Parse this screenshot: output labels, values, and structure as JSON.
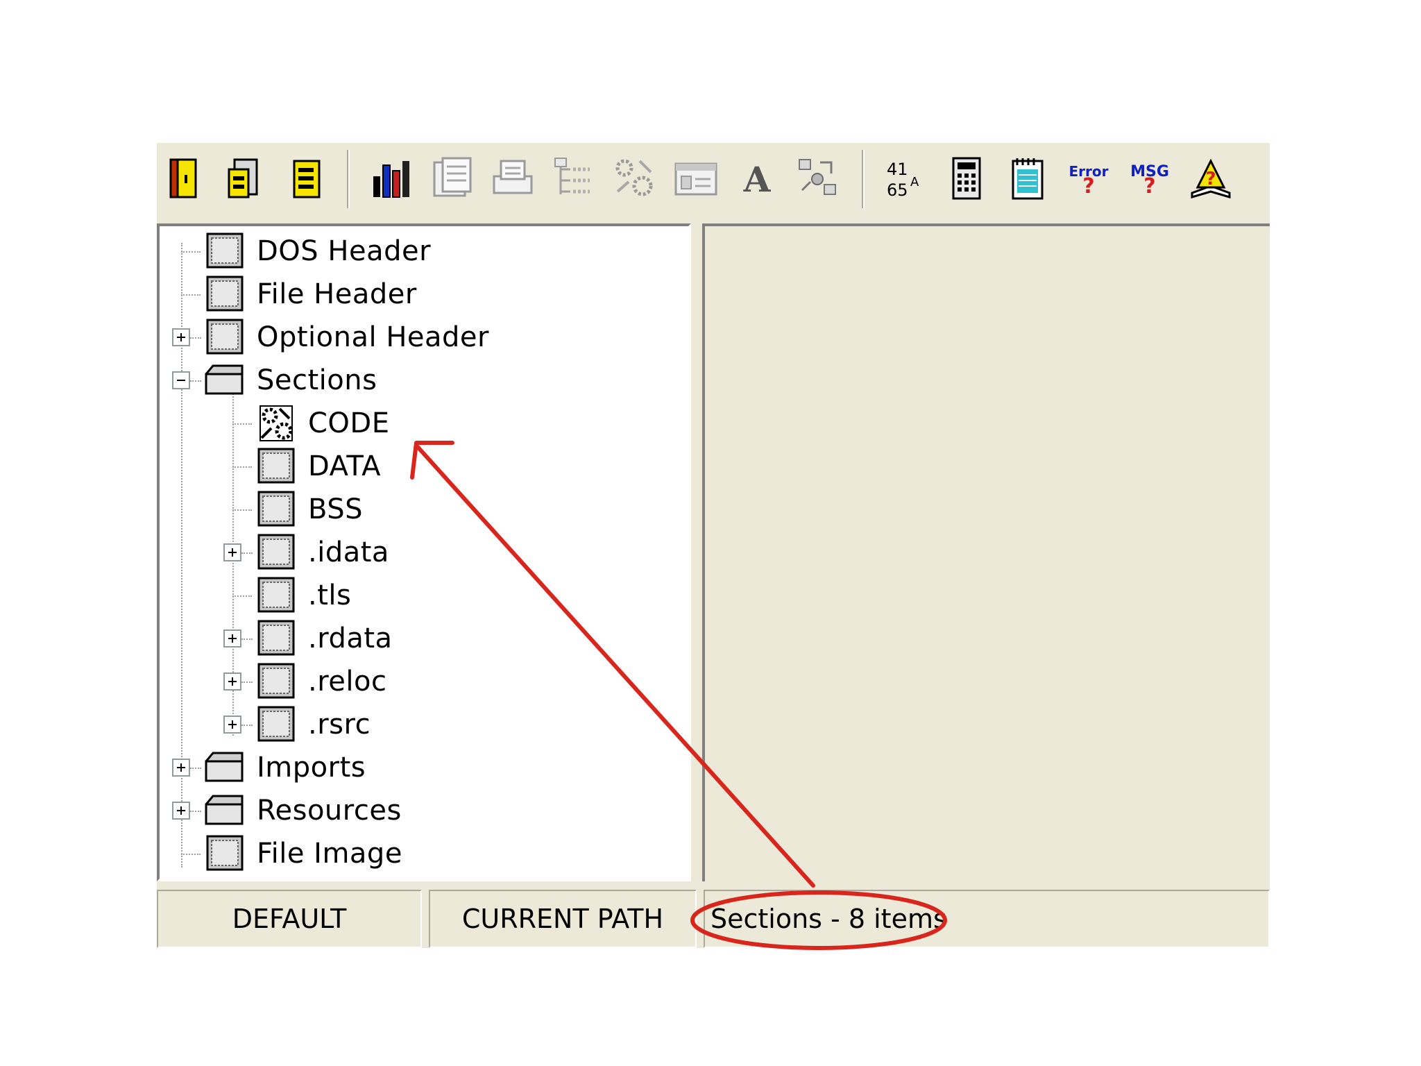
{
  "toolbar": {
    "buttons": [
      {
        "name": "open-file-icon"
      },
      {
        "name": "save-file-icon"
      },
      {
        "name": "save-as-icon"
      },
      {
        "name": "statistics-icon"
      },
      {
        "name": "hex-view-icon"
      },
      {
        "name": "print-icon"
      },
      {
        "name": "tree-view-icon"
      },
      {
        "name": "disassemble-icon"
      },
      {
        "name": "window-icon"
      },
      {
        "name": "font-icon",
        "glyph": "A"
      },
      {
        "name": "transform-icon"
      },
      {
        "name": "ascii-hex-icon",
        "glyph_top": "41",
        "glyph_bottom": "65",
        "glyph_side": "A"
      },
      {
        "name": "calculator-icon"
      },
      {
        "name": "notepad-icon"
      },
      {
        "name": "error-lookup-icon",
        "glyph": "Error"
      },
      {
        "name": "message-lookup-icon",
        "glyph": "MSG"
      },
      {
        "name": "help-icon"
      }
    ]
  },
  "tree": {
    "items": [
      {
        "label": "DOS Header",
        "level": 0,
        "icon": "grid",
        "expander": "none"
      },
      {
        "label": "File Header",
        "level": 0,
        "icon": "grid",
        "expander": "none"
      },
      {
        "label": "Optional Header",
        "level": 0,
        "icon": "grid",
        "expander": "plus"
      },
      {
        "label": "Sections",
        "level": 0,
        "icon": "folder",
        "expander": "minus"
      },
      {
        "label": "CODE",
        "level": 1,
        "icon": "code",
        "expander": "none"
      },
      {
        "label": "DATA",
        "level": 1,
        "icon": "grid",
        "expander": "none"
      },
      {
        "label": "BSS",
        "level": 1,
        "icon": "grid",
        "expander": "none"
      },
      {
        "label": ".idata",
        "level": 1,
        "icon": "grid",
        "expander": "plus"
      },
      {
        "label": ".tls",
        "level": 1,
        "icon": "grid",
        "expander": "none"
      },
      {
        "label": ".rdata",
        "level": 1,
        "icon": "grid",
        "expander": "plus"
      },
      {
        "label": ".reloc",
        "level": 1,
        "icon": "grid",
        "expander": "plus"
      },
      {
        "label": ".rsrc",
        "level": 1,
        "icon": "grid",
        "expander": "plus"
      },
      {
        "label": "Imports",
        "level": 0,
        "icon": "folder",
        "expander": "plus"
      },
      {
        "label": "Resources",
        "level": 0,
        "icon": "folder",
        "expander": "plus"
      },
      {
        "label": "File Image",
        "level": 0,
        "icon": "grid",
        "expander": "none"
      }
    ]
  },
  "status": {
    "default": "DEFAULT",
    "current_path": "CURRENT PATH",
    "info": "Sections - 8 items"
  },
  "colors": {
    "face": "#ece9d8",
    "annotation": "#d9261c"
  }
}
